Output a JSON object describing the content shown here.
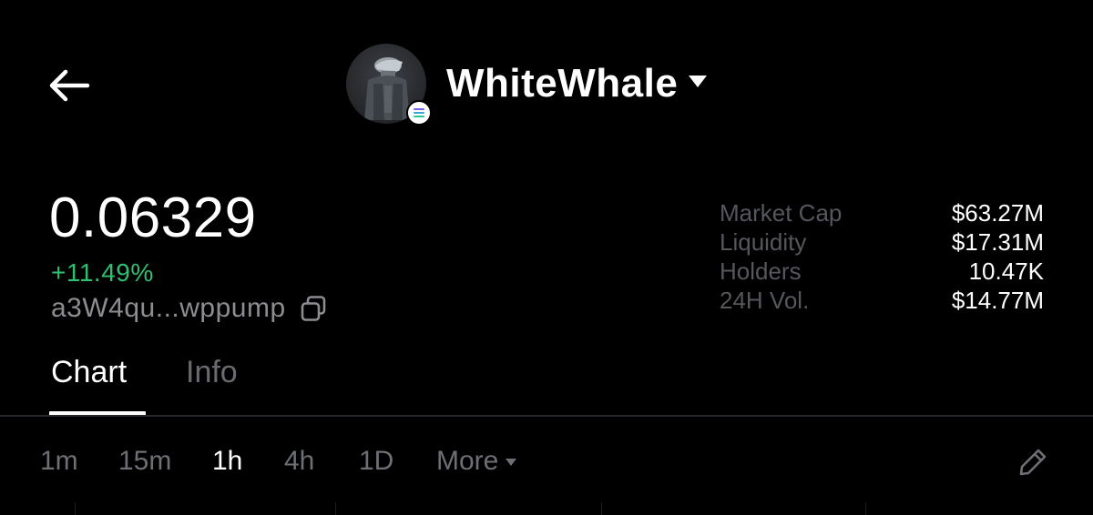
{
  "header": {
    "token_name": "WhiteWhale",
    "back_icon": "arrow-left-icon",
    "avatar_icon": "whale-avatar",
    "chain_badge_icon": "solana-icon"
  },
  "price": {
    "value": "0.06329",
    "change": "+11.49%",
    "change_color": "#2fbf71",
    "address": "a3W4qu...wppump",
    "copy_icon": "copy-icon"
  },
  "stats": [
    {
      "label": "Market Cap",
      "value": "$63.27M"
    },
    {
      "label": "Liquidity",
      "value": "$17.31M"
    },
    {
      "label": "Holders",
      "value": "10.47K"
    },
    {
      "label": "24H Vol.",
      "value": "$14.77M"
    }
  ],
  "tabs": [
    {
      "label": "Chart",
      "active": true
    },
    {
      "label": "Info",
      "active": false
    }
  ],
  "intervals": [
    {
      "label": "1m",
      "active": false
    },
    {
      "label": "15m",
      "active": false
    },
    {
      "label": "1h",
      "active": true
    },
    {
      "label": "4h",
      "active": false
    },
    {
      "label": "1D",
      "active": false
    }
  ],
  "more_label": "More",
  "edit_icon": "pencil-icon",
  "colors": {
    "background": "#000000",
    "text_primary": "#ffffff",
    "text_muted": "#6e6f74",
    "accent_positive": "#2fbf71"
  }
}
